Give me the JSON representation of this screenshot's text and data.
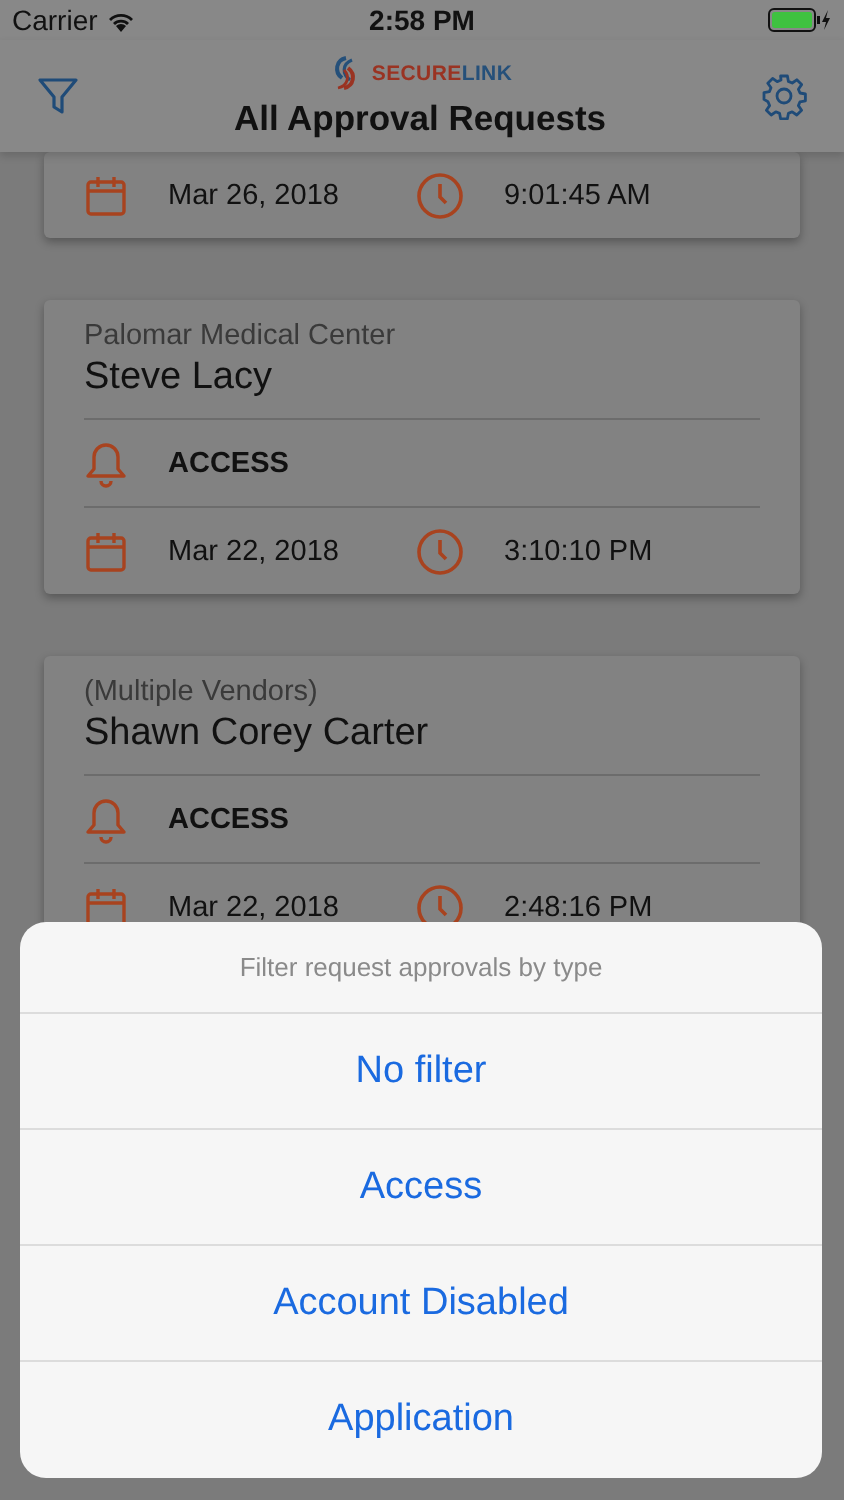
{
  "status_bar": {
    "carrier": "Carrier",
    "time": "2:58 PM"
  },
  "nav": {
    "logo": [
      "SECURE",
      "LINK"
    ],
    "title": "All Approval Requests"
  },
  "requests": [
    {
      "date": "Mar 26, 2018",
      "time": "9:01:45 AM"
    },
    {
      "company": "Palomar Medical Center",
      "name": "Steve Lacy",
      "type": "ACCESS",
      "date": "Mar 22, 2018",
      "time": "3:10:10 PM"
    },
    {
      "company": "(Multiple Vendors)",
      "name": "Shawn Corey Carter",
      "type": "ACCESS",
      "date": "Mar 22, 2018",
      "time": "2:48:16 PM"
    }
  ],
  "action_sheet": {
    "title": "Filter request approvals by type",
    "options": [
      "No filter",
      "Access",
      "Account Disabled",
      "Application"
    ]
  }
}
